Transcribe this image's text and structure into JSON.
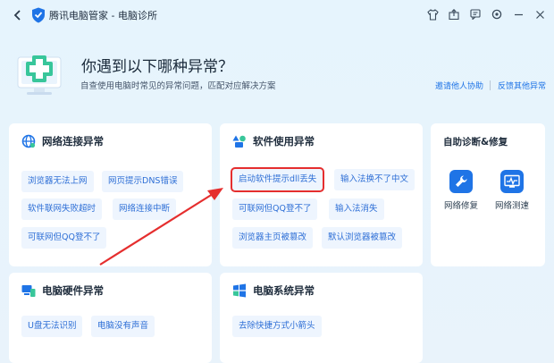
{
  "window": {
    "title": "腾讯电脑管家 - 电脑诊所",
    "back_icon": "chevron-left-icon",
    "controls": [
      "tshirt-skin-icon",
      "share-icon",
      "feedback-icon",
      "settings-icon",
      "minimize-icon",
      "close-icon"
    ]
  },
  "hero": {
    "title": "你遇到以下哪种异常？",
    "subtitle": "自查使用电脑时常见的异常问题，匹配对应解决方案",
    "link_help": "邀请他人协助",
    "link_feedback": "反馈其他异常"
  },
  "network": {
    "title": "网络连接异常",
    "items": [
      "浏览器无法上网",
      "网页提示DNS错误",
      "软件联网失败超时",
      "网络连接中断",
      "可联网但QQ登不了"
    ]
  },
  "software": {
    "title": "软件使用异常",
    "items": [
      "启动软件提示dll丢失",
      "输入法换不了中文",
      "可联网但QQ登不了",
      "输入法消失",
      "浏览器主页被篡改",
      "默认浏览器被篡改"
    ]
  },
  "self_diag": {
    "title": "自助诊断&修复",
    "tools": [
      {
        "label": "网络修复",
        "icon": "wrench-icon"
      },
      {
        "label": "网络测速",
        "icon": "speed-monitor-icon"
      }
    ]
  },
  "hardware": {
    "title": "电脑硬件异常",
    "items": [
      "U盘无法识别",
      "电脑没有声音"
    ]
  },
  "system": {
    "title": "电脑系统异常",
    "items": [
      "去除快捷方式小箭头"
    ]
  },
  "colors": {
    "accent": "#1f74e6",
    "chip_bg": "#eef5fe",
    "chip_text": "#2e6fd6",
    "annotation_red": "#e52e2e"
  }
}
